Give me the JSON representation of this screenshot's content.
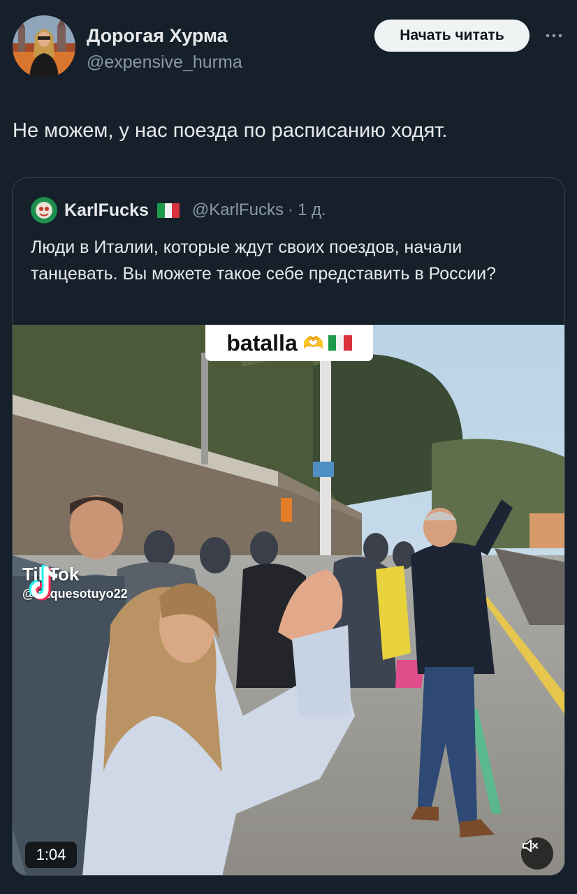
{
  "author": {
    "name": "Дорогая Хурма",
    "handle": "@expensive_hurma",
    "follow_label": "Начать читать",
    "more_icon": "more-horizontal-icon"
  },
  "tweet": {
    "text": "Не можем, у нас поезда по расписанию ходят."
  },
  "quoted": {
    "name": "KarlFucks",
    "flag": "italy-flag",
    "handle": "@KarlFucks",
    "separator": "·",
    "time": "1 д.",
    "text": "Люди в Италии, которые ждут своих поездов, начали танцевать. Вы можете такое себе представить в России?",
    "video": {
      "caption": "batalla",
      "caption_emoji": "🫶",
      "watermark_brand": "TikTok",
      "watermark_user": "@ raquesotuyo22",
      "duration": "1:04",
      "mute_icon": "volume-muted-icon"
    }
  },
  "colors": {
    "background": "#15202b",
    "text": "#e7e9ea",
    "secondary": "#8b98a5",
    "border": "#38444d",
    "button_bg": "#eff3f4"
  }
}
